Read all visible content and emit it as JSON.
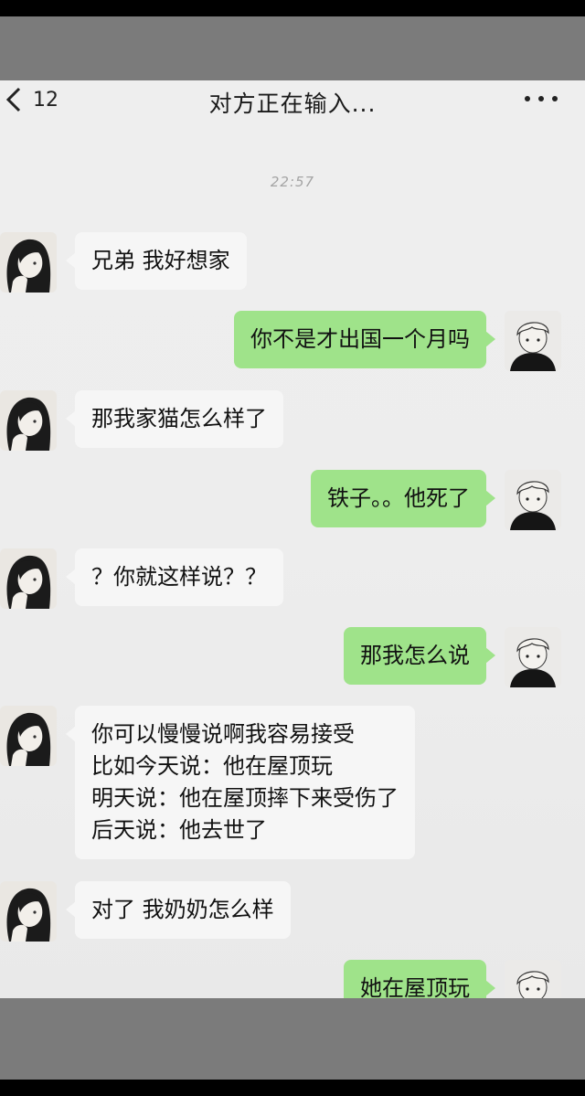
{
  "header": {
    "back_count": "12",
    "title": "对方正在输入..."
  },
  "timestamp": "22:57",
  "messages": [
    {
      "from": "them",
      "text": "兄弟 我好想家"
    },
    {
      "from": "me",
      "text": "你不是才出国一个月吗"
    },
    {
      "from": "them",
      "text": "那我家猫怎么样了"
    },
    {
      "from": "me",
      "text": "铁子。。他死了"
    },
    {
      "from": "them",
      "text": "？你就这样说？？"
    },
    {
      "from": "me",
      "text": "那我怎么说"
    },
    {
      "from": "them",
      "text": "你可以慢慢说啊我容易接受\n比如今天说：他在屋顶玩\n明天说：他在屋顶摔下来受伤了\n后天说：他去世了"
    },
    {
      "from": "them",
      "text": "对了 我奶奶怎么样"
    },
    {
      "from": "me",
      "text": "她在屋顶玩"
    }
  ],
  "colors": {
    "sent_bubble": "#9fe38a",
    "received_bubble": "#f6f6f6",
    "background": "#ededed"
  }
}
